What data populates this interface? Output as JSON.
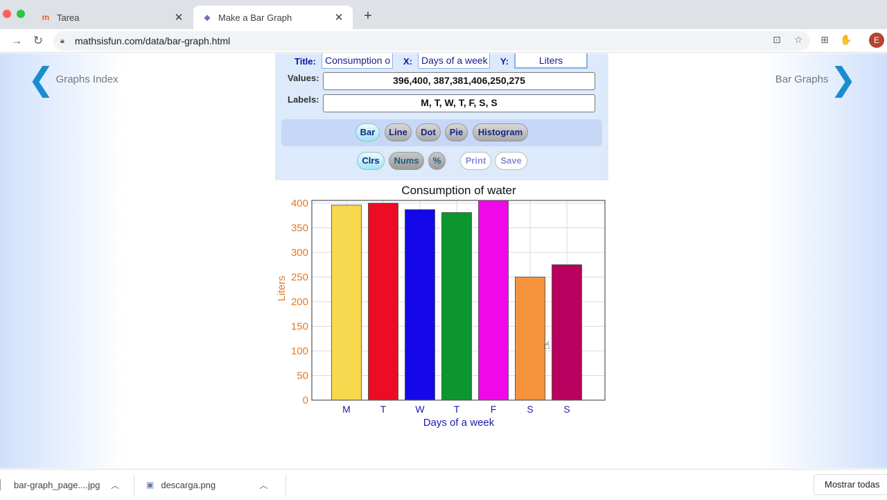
{
  "browser": {
    "tabs": [
      {
        "title": "Tarea",
        "favicon": "moodle-icon"
      },
      {
        "title": "Make a Bar Graph",
        "favicon": "mathsisfun-icon"
      }
    ],
    "url": "mathsisfun.com/data/bar-graph.html",
    "avatar_letter": "E"
  },
  "page": {
    "nav_prev": "Graphs Index",
    "nav_next": "Bar Graphs",
    "form": {
      "title_label": "Title:",
      "title_value": "Consumption o",
      "x_label": "X:",
      "x_value": "Days of a week",
      "y_label": "Y:",
      "y_value": "Liters",
      "values_label": "Values:",
      "values_value": "396,400, 387,381,406,250,275",
      "labels_label": "Labels:",
      "labels_value": "M, T, W, T, F, S, S"
    },
    "types": [
      "Bar",
      "Line",
      "Dot",
      "Pie",
      "Histogram"
    ],
    "options": [
      "Clrs",
      "Nums",
      "%"
    ],
    "actions": [
      "Print",
      "Save"
    ]
  },
  "chart_data": {
    "type": "bar",
    "title": "Consumption of water",
    "xlabel": "Days of a week",
    "ylabel": "Liters",
    "categories": [
      "M",
      "T",
      "W",
      "T",
      "F",
      "S",
      "S"
    ],
    "values": [
      396,
      400,
      387,
      381,
      406,
      250,
      275
    ],
    "ylim": [
      0,
      400
    ],
    "yticks": [
      0,
      50,
      100,
      150,
      200,
      250,
      300,
      350,
      400
    ],
    "colors": [
      "#f8d84f",
      "#ec0c24",
      "#1408e8",
      "#0d9630",
      "#f008e8",
      "#f5923c",
      "#b8005e"
    ],
    "grid": true
  },
  "downloads": {
    "items": [
      "bar-graph_page....jpg",
      "descarga.png"
    ],
    "show_all": "Mostrar todas"
  }
}
